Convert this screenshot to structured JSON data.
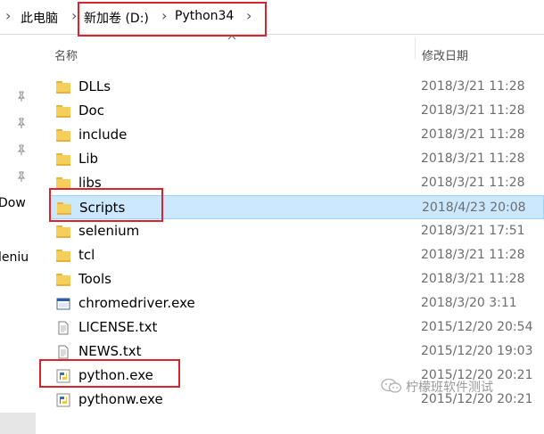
{
  "breadcrumb": {
    "items": [
      "此电脑",
      "新加卷 (D:)",
      "Python34"
    ]
  },
  "columns": {
    "name": "名称",
    "date": "修改日期"
  },
  "nav": {
    "items": [
      "Dow",
      "leniu"
    ]
  },
  "files": [
    {
      "name": "DLLs",
      "date": "2018/3/21 11:28",
      "icon": "folder-icon"
    },
    {
      "name": "Doc",
      "date": "2018/3/21 11:28",
      "icon": "folder-icon"
    },
    {
      "name": "include",
      "date": "2018/3/21 11:28",
      "icon": "folder-icon"
    },
    {
      "name": "Lib",
      "date": "2018/3/21 11:28",
      "icon": "folder-icon"
    },
    {
      "name": "libs",
      "date": "2018/3/21 11:28",
      "icon": "folder-icon"
    },
    {
      "name": "Scripts",
      "date": "2018/4/23 20:08",
      "icon": "folder-icon",
      "selected": true
    },
    {
      "name": "selenium",
      "date": "2018/3/21 17:51",
      "icon": "folder-icon"
    },
    {
      "name": "tcl",
      "date": "2018/3/21 11:28",
      "icon": "folder-icon"
    },
    {
      "name": "Tools",
      "date": "2018/3/21 11:28",
      "icon": "folder-icon"
    },
    {
      "name": "chromedriver.exe",
      "date": "2018/3/20 3:11",
      "icon": "exe-window-icon"
    },
    {
      "name": "LICENSE.txt",
      "date": "2015/12/20 20:54",
      "icon": "text-file-icon"
    },
    {
      "name": "NEWS.txt",
      "date": "2015/12/20 19:03",
      "icon": "text-file-icon"
    },
    {
      "name": "python.exe",
      "date": "2015/12/20 20:21",
      "icon": "python-icon"
    },
    {
      "name": "pythonw.exe",
      "date": "2015/12/20 20:21",
      "icon": "python-icon"
    }
  ],
  "watermark": "柠檬班软件测试",
  "colors": {
    "highlight_box": "#d9232f",
    "selection_bg": "#cce8ff",
    "folder": "#f6cf5b"
  }
}
